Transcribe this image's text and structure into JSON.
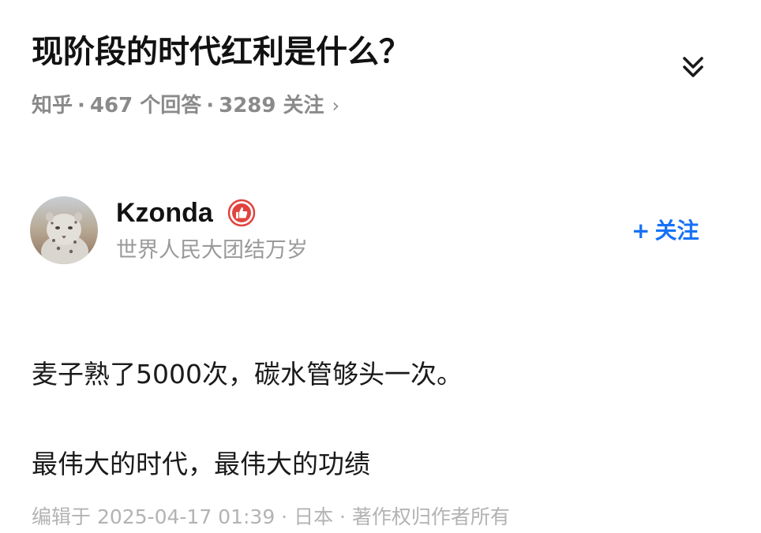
{
  "question": {
    "title": "现阶段的时代红利是什么？",
    "source": "知乎",
    "answers": "467 个回答",
    "followers": "3289 关注",
    "separator": "·",
    "more_glyph": "›"
  },
  "icons": {
    "collapse": "double-chevron-down-icon",
    "badge": "thumbs-up-badge-icon",
    "avatar": "snow-leopard-avatar"
  },
  "author": {
    "name": "Kzonda",
    "bio": "世界人民大团结万岁",
    "follow_label": "关注",
    "follow_plus": "+"
  },
  "answer": {
    "paragraphs": [
      "麦子熟了5000次，碳水管够头一次。",
      "最伟大的时代，最伟大的功绩"
    ],
    "footer": "编辑于 2025-04-17 01:39 · 日本 · 著作权归作者所有"
  },
  "colors": {
    "accent": "#1772f6",
    "badge": "#e0443e",
    "meta_text": "#8a8a8a",
    "bio_text": "#9a9a9a"
  }
}
